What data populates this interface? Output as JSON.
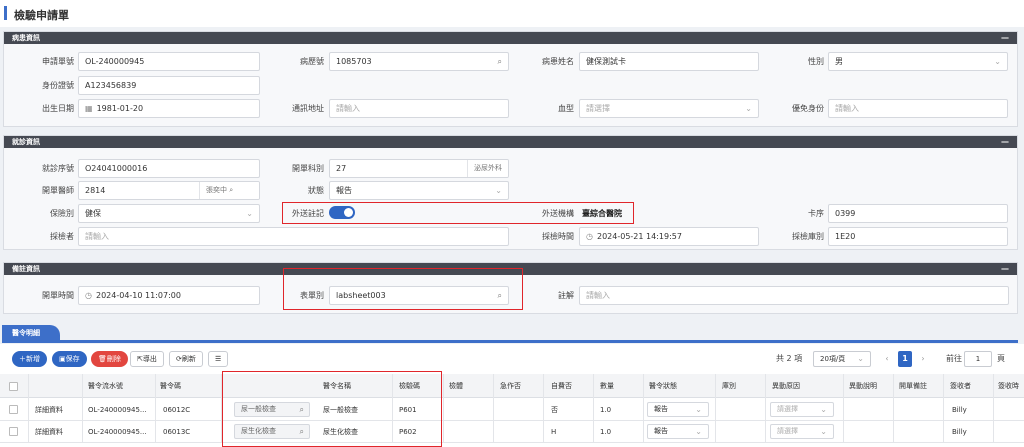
{
  "page_title": "檢驗申請單",
  "patient": {
    "header": "病患資訊",
    "app_no_label": "申請單號",
    "app_no": "OL-240000945",
    "chart_no_label": "病歷號",
    "chart_no": "1085703",
    "name_label": "病患姓名",
    "name": "健保測試卡",
    "sex_label": "性別",
    "sex": "男",
    "id_label": "身份證號",
    "id": "A123456839",
    "dob_label": "出生日期",
    "dob": "1981-01-20",
    "addr_label": "通訊地址",
    "addr_ph": "請輸入",
    "blood_label": "血型",
    "blood_ph": "請選擇",
    "exempt_label": "優免身份",
    "exempt_ph": "請輸入"
  },
  "visit": {
    "header": "就診資訊",
    "visit_no_label": "就診序號",
    "visit_no": "O24041000016",
    "dept_label": "開單科別",
    "dept_code": "27",
    "dept_name": "泌尿外科",
    "doctor_label": "開單醫師",
    "doctor_code": "2814",
    "doctor_name": "張奕中",
    "status_label": "狀態",
    "status": "報告",
    "ins_label": "保險別",
    "ins": "健保",
    "outsource_label": "外送註記",
    "outsource_on": true,
    "agency_label": "外送機構",
    "agency": "臺綜合醫院",
    "card_label": "卡序",
    "card": "0399",
    "collector_label": "採檢者",
    "collector_ph": "請輸入",
    "collect_time_label": "採檢時間",
    "collect_time": "2024-05-21 14:19:57",
    "collect_type_label": "採檢庫別",
    "collect_type": "1E20"
  },
  "remarks": {
    "header": "備註資訊",
    "open_time_label": "開單時間",
    "open_time": "2024-04-10 11:07:00",
    "form_label": "表單別",
    "form": "labsheet003",
    "note_label": "註解",
    "note_ph": "請輸入"
  },
  "orders": {
    "tab": "醫令明細",
    "btn_add": "新增",
    "btn_save": "保存",
    "btn_delete": "刪除",
    "btn_export": "導出",
    "btn_refresh": "刷新",
    "total": "共 2 項",
    "page_size": "20項/頁",
    "current_page": "1",
    "goto_label": "前往",
    "goto_value": "1",
    "page_unit": "頁",
    "columns": [
      "醫令流水號",
      "醫令碼",
      "醫令名稱",
      "檢驗碼",
      "檢體",
      "急作否",
      "自費否",
      "數量",
      "醫令狀態",
      "庫別",
      "異動原因",
      "異動說明",
      "開單備註",
      "簽收者",
      "簽收時"
    ],
    "rows": [
      {
        "detail": "詳細資料",
        "serial": "OL-240000945...",
        "code": "06012C",
        "search": "尿一般檢查",
        "name": "尿一般檢查",
        "lab_code": "P601",
        "self_pay": "否",
        "qty": "1.0",
        "status": "報告",
        "reason_ph": "請選擇",
        "signer": "Billy"
      },
      {
        "detail": "詳細資料",
        "serial": "OL-240000945...",
        "code": "06013C",
        "search": "尿生化檢查",
        "name": "尿生化檢查",
        "lab_code": "P602",
        "self_pay": "H",
        "qty": "1.0",
        "status": "報告",
        "reason_ph": "請選擇",
        "signer": "Billy"
      }
    ]
  }
}
